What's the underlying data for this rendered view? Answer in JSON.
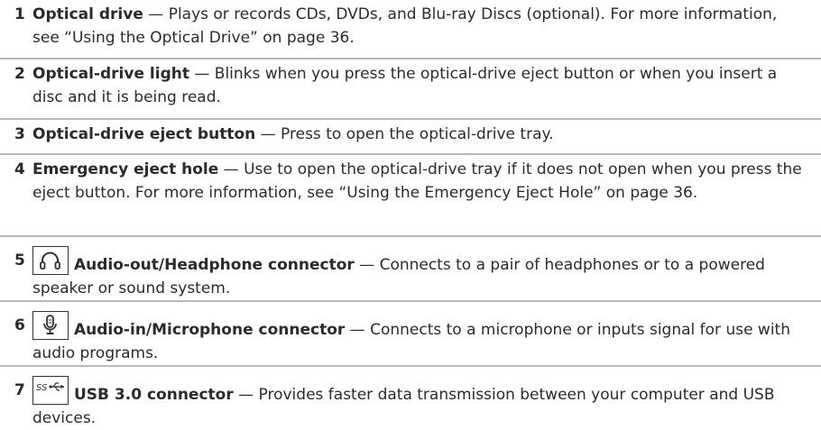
{
  "items": [
    {
      "number": "1",
      "title": "Optical drive",
      "dash": " — ",
      "desc": "Plays or records CDs, DVDs, and Blu-ray Discs (optional). For more information, see “Using the Optical Drive” on page 36."
    },
    {
      "number": "2",
      "title": "Optical-drive light",
      "dash": " — ",
      "desc": "Blinks when you press the optical-drive eject button or when you insert a disc and it is being read."
    },
    {
      "number": "3",
      "title": "Optical-drive eject button",
      "dash": " — ",
      "desc": "Press to open the optical-drive tray."
    },
    {
      "number": "4",
      "title": "Emergency eject hole",
      "dash": " — ",
      "desc": "Use to open the optical-drive tray if it does not open when you press the eject button. For more information, see “Using the Emergency Eject Hole” on page 36."
    },
    {
      "number": "5",
      "icon": "headphone-icon",
      "title": "Audio-out/Headphone connector",
      "dash": " — ",
      "desc": "Connects to a pair of headphones or to a powered speaker or sound system."
    },
    {
      "number": "6",
      "icon": "microphone-icon",
      "title": "Audio-in/Microphone connector",
      "dash": " — ",
      "desc": "Connects to a microphone or inputs signal for use with audio programs."
    },
    {
      "number": "7",
      "icon": "usb-ss-icon",
      "title": "USB 3.0 connector",
      "dash": " — ",
      "desc": "Provides faster data transmission between your computer and USB devices."
    }
  ]
}
